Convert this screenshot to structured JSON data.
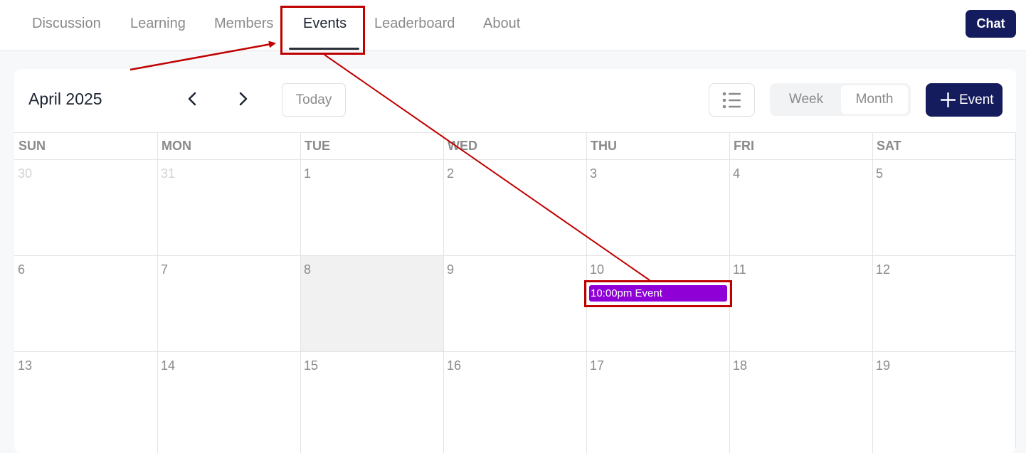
{
  "nav": {
    "tabs": [
      {
        "label": "Discussion"
      },
      {
        "label": "Learning"
      },
      {
        "label": "Members"
      },
      {
        "label": "Events"
      },
      {
        "label": "Leaderboard"
      },
      {
        "label": "About"
      }
    ],
    "active_tab": "Events",
    "chat_label": "Chat"
  },
  "toolbar": {
    "month_title": "April 2025",
    "prev_icon": "chevron-left-icon",
    "next_icon": "chevron-right-icon",
    "today_label": "Today",
    "list_icon": "list-icon",
    "view_week": "Week",
    "view_month": "Month",
    "selected_view": "Month",
    "add_event_label": "Event",
    "add_icon": "plus-icon"
  },
  "calendar": {
    "weekdays": [
      "SUN",
      "MON",
      "TUE",
      "WED",
      "THU",
      "FRI",
      "SAT"
    ],
    "weeks": [
      [
        "30",
        "31",
        "1",
        "2",
        "3",
        "4",
        "5"
      ],
      [
        "6",
        "7",
        "8",
        "9",
        "10",
        "11",
        "12"
      ],
      [
        "13",
        "14",
        "15",
        "16",
        "17",
        "18",
        "19"
      ]
    ],
    "today": "8",
    "event": {
      "day": "10",
      "label": "10:00pm Event"
    }
  },
  "colors": {
    "brand": "#151c5e",
    "event": "#8f00d6",
    "annotation": "#c00000"
  }
}
